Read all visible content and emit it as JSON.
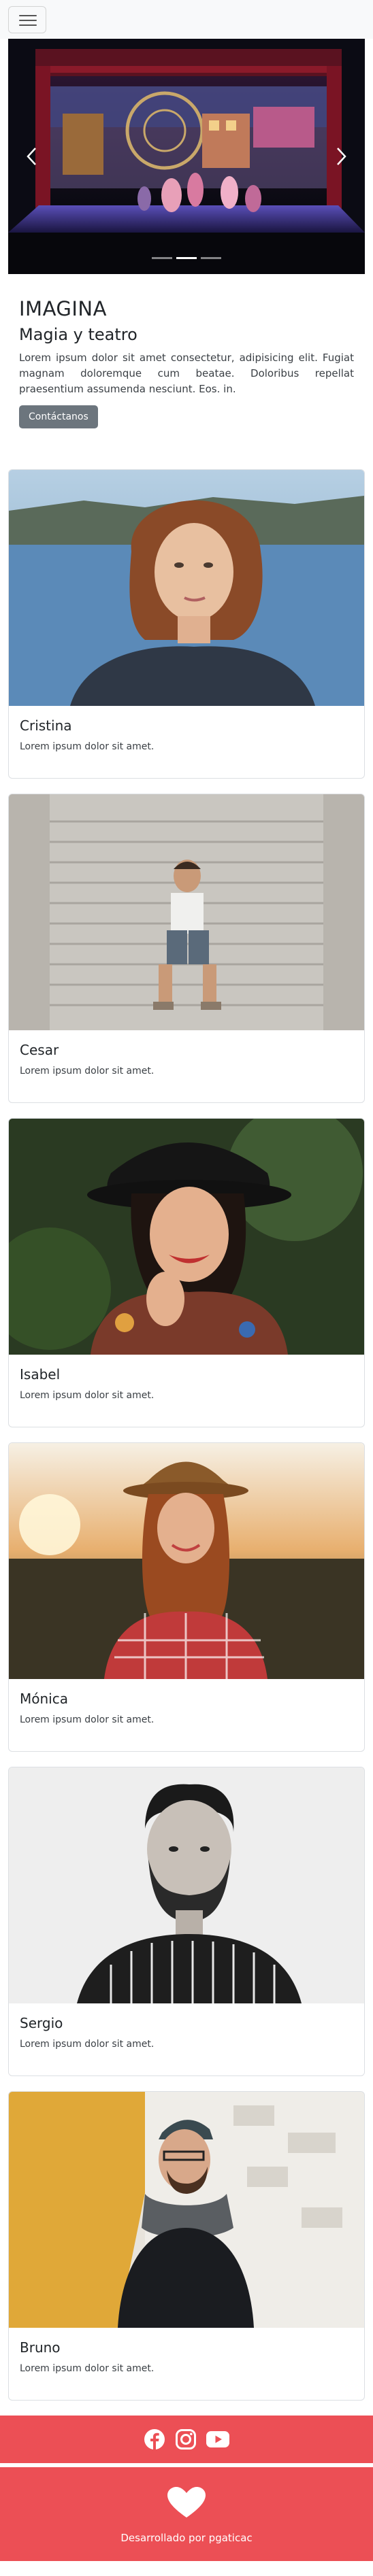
{
  "navbar": {
    "toggle_icon": "hamburger-icon"
  },
  "carousel": {
    "indicators": 3,
    "active_index": 1,
    "prev_icon": "chevron-left-icon",
    "next_icon": "chevron-right-icon"
  },
  "intro": {
    "title": "IMAGINA",
    "subtitle": "Magia y teatro",
    "paragraph": "Lorem ipsum dolor sit amet consectetur, adipisicing elit. Fugiat magnam doloremque cum beatae. Doloribus repellat praesentium assumenda nesciunt. Eos. in.",
    "button_label": "Contáctanos"
  },
  "cards": [
    {
      "name": "Cristina",
      "text": "Lorem ipsum dolor sit amet."
    },
    {
      "name": "Cesar",
      "text": "Lorem ipsum dolor sit amet."
    },
    {
      "name": "Isabel",
      "text": "Lorem ipsum dolor sit amet."
    },
    {
      "name": "Mónica",
      "text": "Lorem ipsum dolor sit amet."
    },
    {
      "name": "Sergio",
      "text": "Lorem ipsum dolor sit amet."
    },
    {
      "name": "Bruno",
      "text": "Lorem ipsum dolor sit amet."
    }
  ],
  "social": {
    "icons": [
      "facebook-icon",
      "instagram-icon",
      "youtube-icon"
    ]
  },
  "footer": {
    "credit": "Desarrollado por pgaticac",
    "icon": "heart-icon"
  },
  "colors": {
    "footer_bg": "#ec4f55",
    "button_bg": "#6c757d",
    "navbar_bg": "#f8f9fa"
  }
}
